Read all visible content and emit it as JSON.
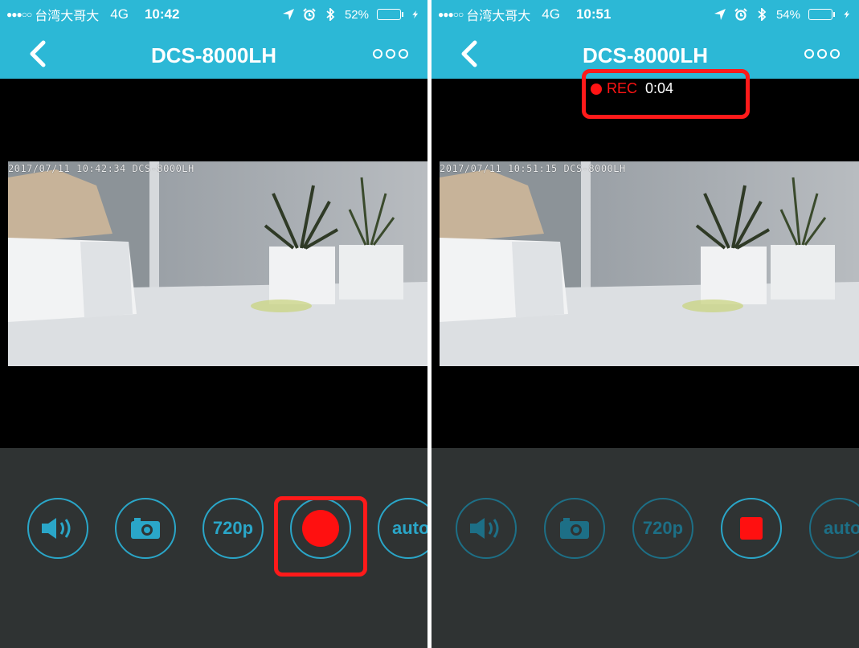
{
  "colors": {
    "accent": "#2cb8d6",
    "record_red": "#ff1414",
    "control_blue": "#2aa6c8",
    "control_bg": "#2f3333"
  },
  "left": {
    "status": {
      "signal": "●●●○○",
      "carrier": "台湾大哥大",
      "network": "4G",
      "time": "10:42",
      "battery": "52%",
      "battery_level": 0.52
    },
    "header": {
      "title": "DCS-8000LH",
      "back_icon": "chevron-left-icon",
      "more_icon": "more-dots-icon"
    },
    "feed": {
      "timestamp": "2017/07/11  10:42:34 DCS-8000LH"
    },
    "controls": {
      "resolution": "720p",
      "auto": "auto",
      "state": "record"
    }
  },
  "right": {
    "status": {
      "signal": "●●●○○",
      "carrier": "台湾大哥大",
      "network": "4G",
      "time": "10:51",
      "battery": "54%",
      "battery_level": 0.54
    },
    "header": {
      "title": "DCS-8000LH",
      "back_icon": "chevron-left-icon",
      "more_icon": "more-dots-icon"
    },
    "recording": {
      "label": "REC",
      "elapsed": "0:04"
    },
    "feed": {
      "timestamp": "2017/07/11  10:51:15 DCS-8000LH"
    },
    "controls": {
      "resolution": "720p",
      "auto": "auto",
      "state": "stop"
    }
  }
}
